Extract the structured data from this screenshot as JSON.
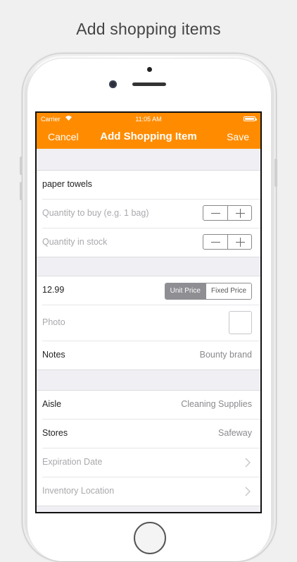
{
  "caption": "Add shopping items",
  "status_bar": {
    "carrier": "Carrier",
    "time": "11:05 AM"
  },
  "nav": {
    "cancel": "Cancel",
    "title": "Add Shopping Item",
    "save": "Save"
  },
  "colors": {
    "accent": "#ff8c00",
    "background": "#efeff4"
  },
  "item": {
    "name": "paper towels",
    "quantity_to_buy_placeholder": "Quantity to buy (e.g. 1 bag)",
    "quantity_in_stock_placeholder": "Quantity in stock"
  },
  "pricing": {
    "price": "12.99",
    "segments": [
      "Unit Price",
      "Fixed Price"
    ],
    "selected_segment": "Unit Price",
    "photo_label": "Photo",
    "notes_label": "Notes",
    "notes_value": "Bounty brand"
  },
  "location": {
    "aisle_label": "Aisle",
    "aisle_value": "Cleaning Supplies",
    "stores_label": "Stores",
    "stores_value": "Safeway",
    "expiration_label": "Expiration Date",
    "inventory_label": "Inventory Location"
  }
}
